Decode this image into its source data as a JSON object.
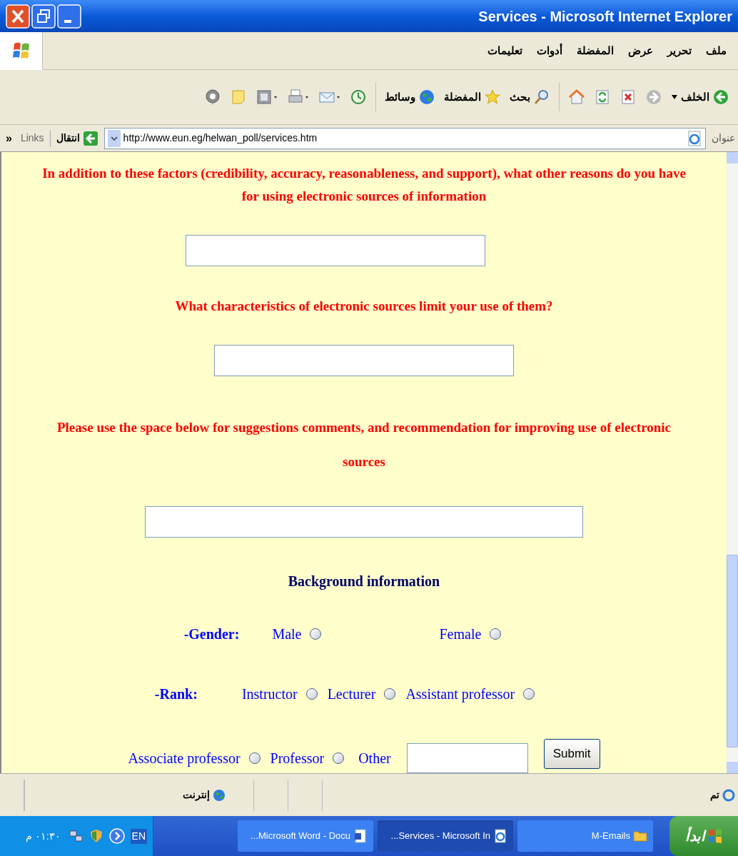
{
  "window": {
    "title": "Services - Microsoft Internet Explorer"
  },
  "menu": [
    "ملف",
    "تحرير",
    "عرض",
    "المفضلة",
    "أدوات",
    "تعليمات"
  ],
  "toolbar": [
    {
      "kind": "back",
      "label": "الخلف"
    },
    {
      "kind": "forward"
    },
    {
      "kind": "stop"
    },
    {
      "kind": "refresh"
    },
    {
      "kind": "home"
    },
    {
      "kind": "search",
      "label": "بحث"
    },
    {
      "kind": "favorites",
      "label": "المفضلة"
    },
    {
      "kind": "media",
      "label": "وسائط"
    },
    {
      "kind": "history"
    },
    {
      "kind": "mail"
    },
    {
      "kind": "print"
    },
    {
      "kind": "edit"
    },
    {
      "kind": "note"
    },
    {
      "kind": "discuss"
    }
  ],
  "address": {
    "label": "عنوان",
    "url": "http://www.eun.eg/helwan_poll/services.htm",
    "go": "انتقال",
    "links": "Links",
    "chevron": "»"
  },
  "questions": [
    {
      "text": "In addition to these factors (credibility, accuracy, reasonableness, and support), what other reasons do you have for using electronic sources of information"
    },
    {
      "text": "What characteristics of electronic sources limit your use of them?"
    },
    {
      "text": "Please use the space below for suggestions comments, and recommendation for improving use of electronic sources"
    }
  ],
  "background": {
    "heading": "Background information",
    "gender": {
      "label": "-Gender:",
      "male": {
        "label": "Male",
        "selected": false
      },
      "female": {
        "label": "Female",
        "selected": false
      }
    },
    "rank": {
      "label": "-Rank:",
      "instructor": {
        "label": "Instructor",
        "selected": false
      },
      "lecturer": {
        "label": "Lecturer",
        "selected": false
      },
      "assistant_professor": {
        "label": "Assistant professor",
        "selected": false
      },
      "associate_professor": {
        "label": "Associate professor",
        "selected": false
      },
      "professor": {
        "label": "Professor",
        "selected": false
      }
    },
    "other": "Other",
    "submit": "Submit"
  },
  "status_bar": {
    "status": "تم",
    "zone": "إنترنت"
  },
  "taskbar": {
    "start": "ابدأ",
    "buttons": [
      {
        "label": "M-Emails",
        "kind": "folder",
        "selected": false
      },
      {
        "label": "...Services - Microsoft In",
        "kind": "ie",
        "selected": true
      },
      {
        "label": "...Microsoft Word - Docu",
        "kind": "word",
        "selected": false
      }
    ],
    "language": "EN",
    "clock": "٠١:٣٠ م"
  }
}
